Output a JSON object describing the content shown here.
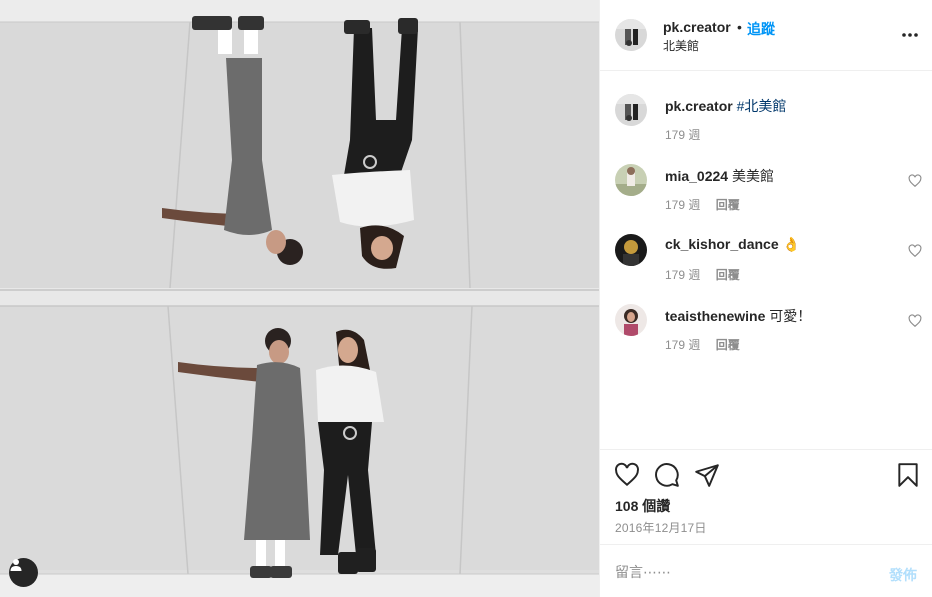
{
  "post": {
    "author": "pk.creator",
    "follow_label": "追蹤",
    "location": "北美館",
    "likes": "108 個讚",
    "date": "2016年12月17日"
  },
  "comments": [
    {
      "user": "pk.creator",
      "text": "",
      "tag": "#北美館",
      "time": "179 週",
      "reply": ""
    },
    {
      "user": "mia_0224",
      "text": "美美館",
      "tag": "",
      "time": "179 週",
      "reply": "回覆"
    },
    {
      "user": "ck_kishor_dance",
      "text": "👌",
      "tag": "",
      "time": "179 週",
      "reply": "回覆"
    },
    {
      "user": "teaisthenewine",
      "text": "可愛！",
      "tag": "",
      "time": "179 週",
      "reply": "回覆"
    }
  ],
  "composer": {
    "placeholder": "留言⋯⋯",
    "post_label": "發佈"
  },
  "colors": {
    "link": "#0095f6",
    "hashtag": "#00376b",
    "secondary_text": "#8e8e8e",
    "post_disabled": "#b2dffc"
  },
  "icons": [
    "more-icon",
    "heart-icon",
    "comment-icon",
    "share-icon",
    "bookmark-icon",
    "user-tag-icon"
  ]
}
